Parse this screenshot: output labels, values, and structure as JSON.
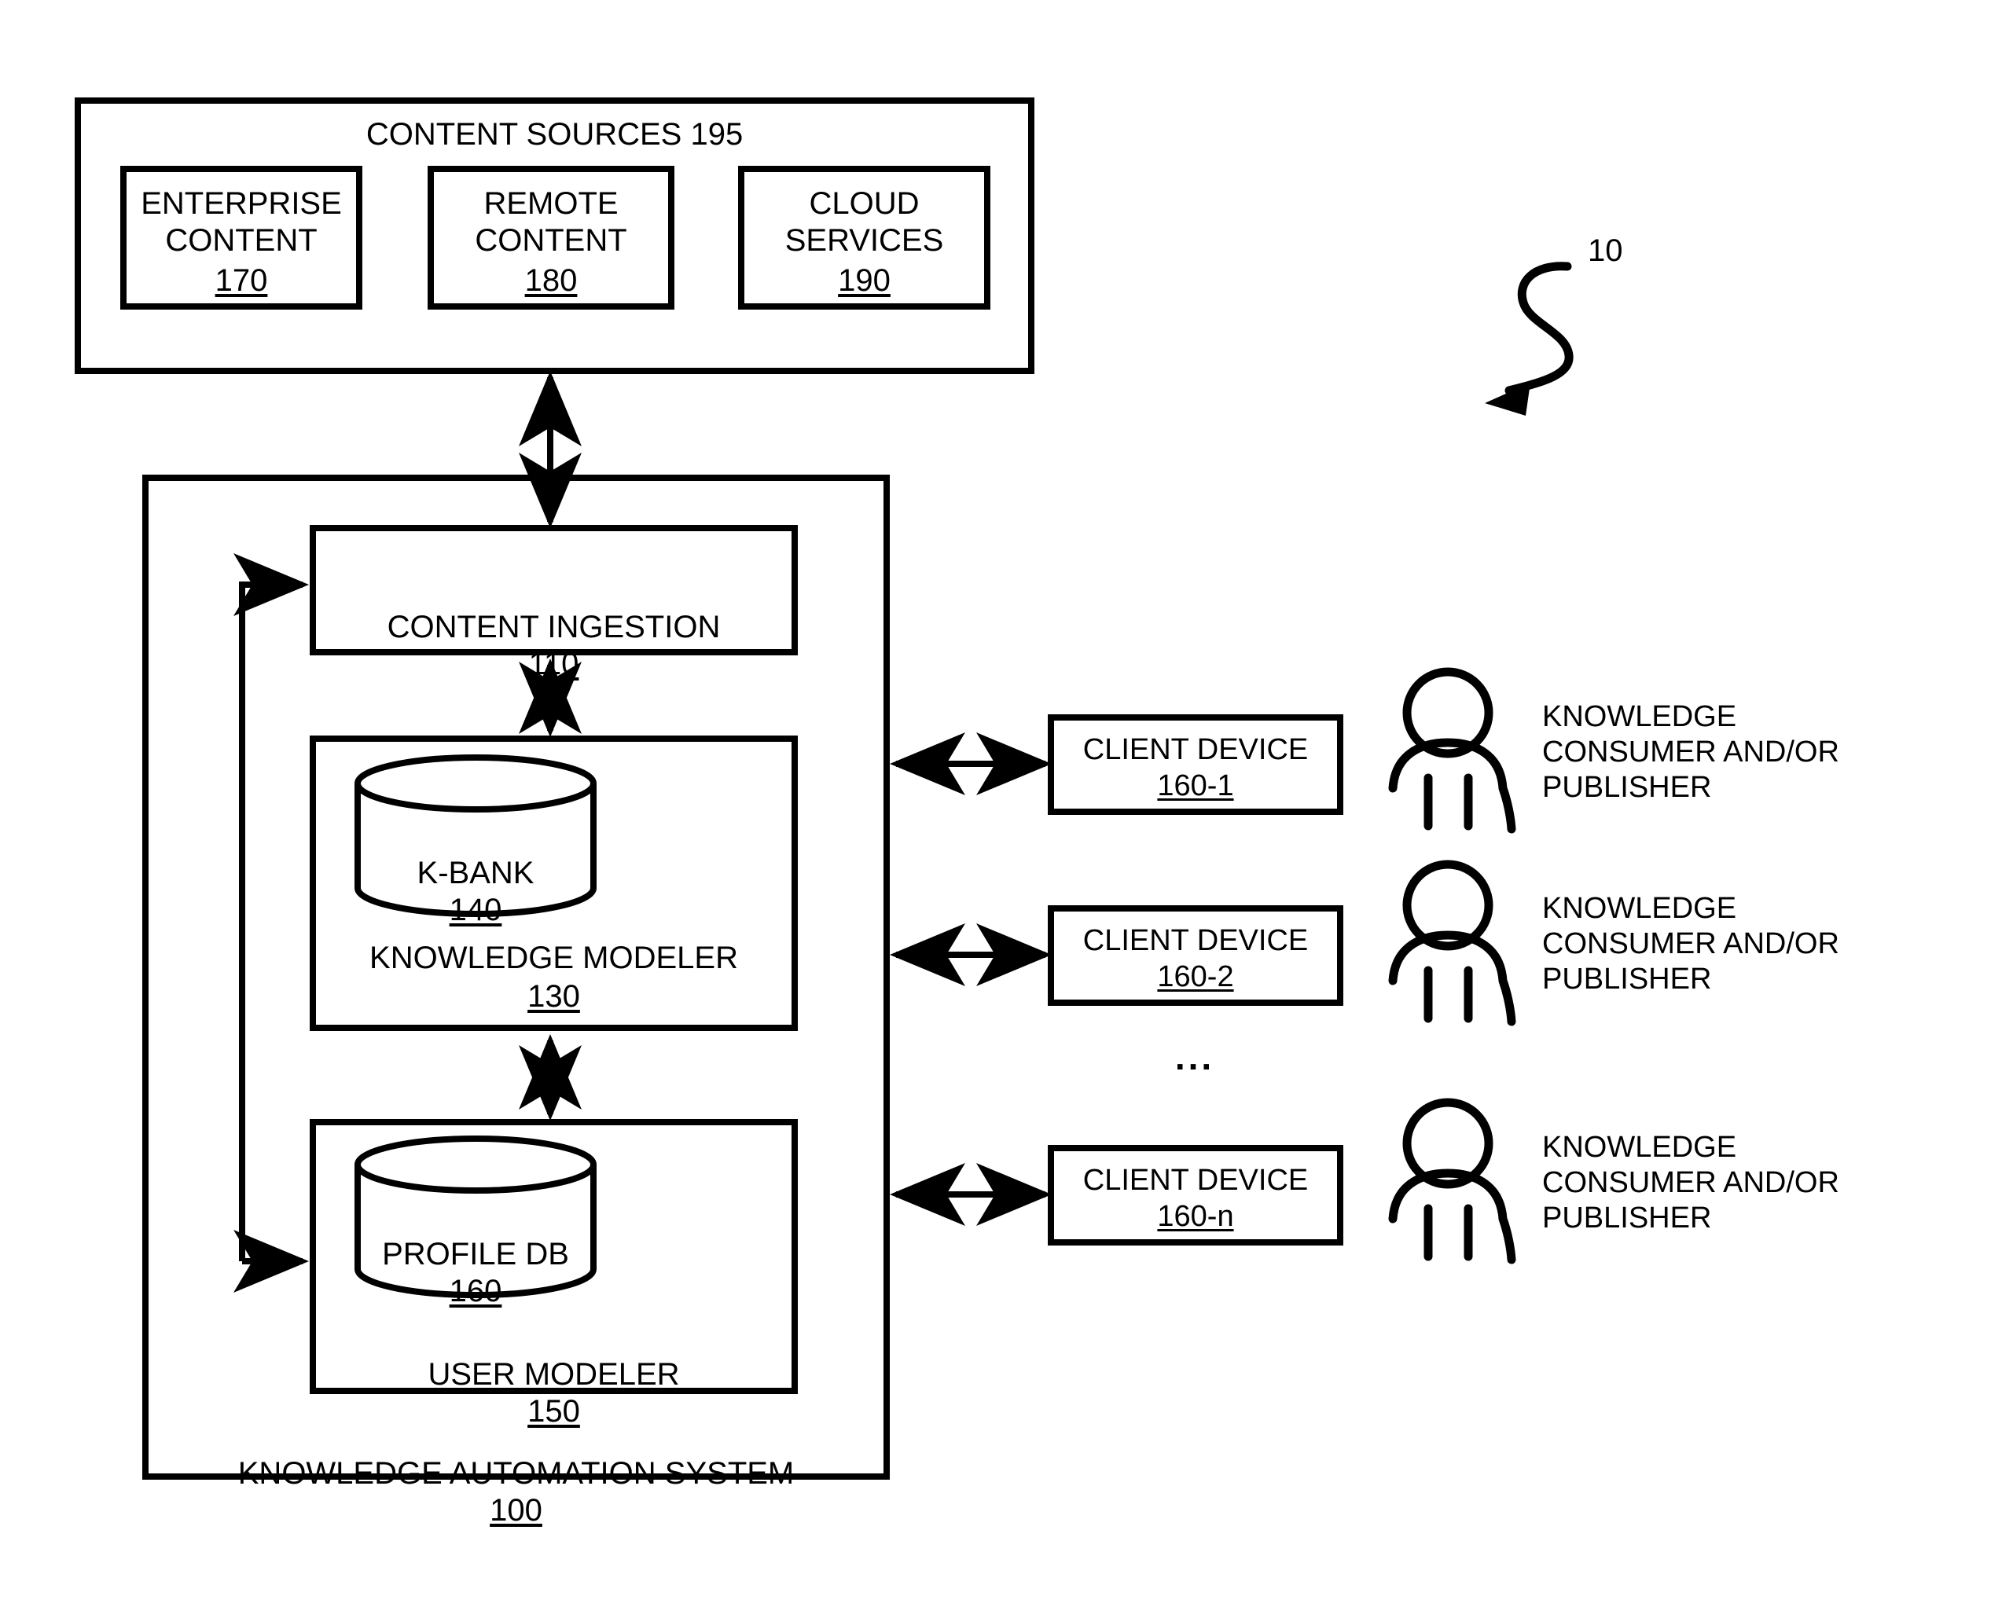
{
  "figure": {
    "reference_numeral": "10",
    "ellipsis": "..."
  },
  "content_sources": {
    "title": "CONTENT SOURCES 195",
    "title_text": "CONTENT SOURCES",
    "title_ref": "195",
    "boxes": [
      {
        "label": "ENTERPRISE\nCONTENT",
        "ref": "170"
      },
      {
        "label": "REMOTE\nCONTENT",
        "ref": "180"
      },
      {
        "label": "CLOUD\nSERVICES",
        "ref": "190"
      }
    ]
  },
  "system": {
    "label": "KNOWLEDGE AUTOMATION SYSTEM",
    "ref": "100",
    "content_ingestion": {
      "label": "CONTENT INGESTION",
      "ref": "110"
    },
    "knowledge_modeler": {
      "label": "KNOWLEDGE MODELER",
      "ref": "130",
      "database": {
        "label": "K-BANK",
        "ref": "140"
      }
    },
    "user_modeler": {
      "label": "USER MODELER",
      "ref": "150",
      "database": {
        "label": "PROFILE DB",
        "ref": "160"
      }
    }
  },
  "clients": [
    {
      "device_label": "CLIENT DEVICE",
      "device_ref": "160-1",
      "actor_label": "KNOWLEDGE\nCONSUMER AND/OR\nPUBLISHER"
    },
    {
      "device_label": "CLIENT DEVICE",
      "device_ref": "160-2",
      "actor_label": "KNOWLEDGE\nCONSUMER AND/OR\nPUBLISHER"
    },
    {
      "device_label": "CLIENT DEVICE",
      "device_ref": "160-n",
      "actor_label": "KNOWLEDGE\nCONSUMER AND/OR\nPUBLISHER"
    }
  ],
  "colors": {
    "stroke": "#000000",
    "background": "#ffffff"
  }
}
